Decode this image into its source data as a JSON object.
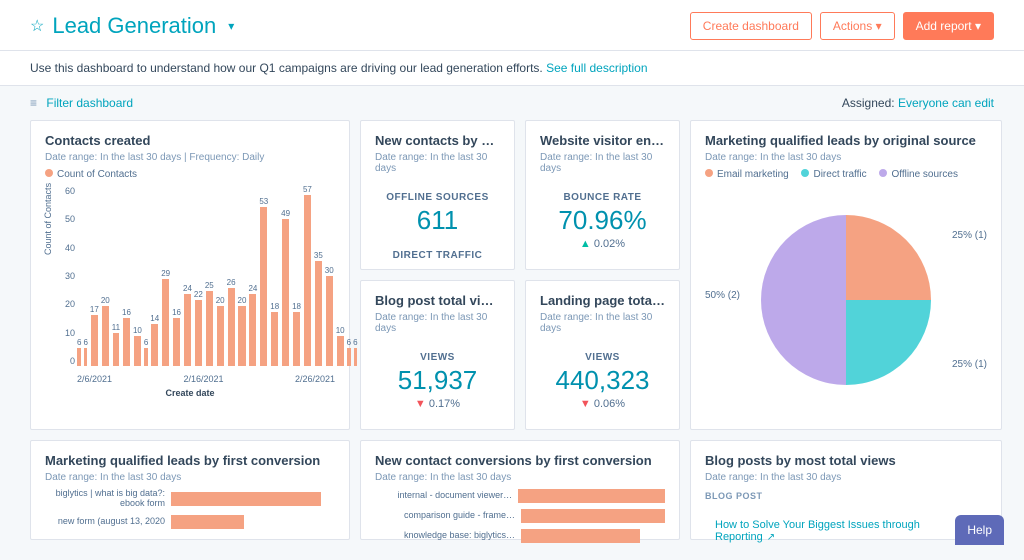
{
  "header": {
    "title": "Lead Generation",
    "create_btn": "Create dashboard",
    "actions_btn": "Actions",
    "add_report_btn": "Add report"
  },
  "description": "Use this dashboard to understand how our Q1 campaigns are driving our lead generation efforts.",
  "see_full": "See full description",
  "filter_label": "Filter dashboard",
  "assigned_label": "Assigned:",
  "assigned_value": "Everyone can edit",
  "cards": {
    "contacts_created": {
      "title": "Contacts created",
      "meta": "Date range: In the last 30 days   |   Frequency: Daily",
      "legend": "Count of Contacts",
      "xtitle": "Create date"
    },
    "new_contacts_source": {
      "title": "New contacts by sou…",
      "meta": "Date range: In the last 30 days",
      "label1": "OFFLINE SOURCES",
      "val1": "611",
      "label2": "DIRECT TRAFFIC"
    },
    "visitor_engagement": {
      "title": "Website visitor enga…",
      "meta": "Date range: In the last 30 days",
      "label": "BOUNCE RATE",
      "value": "70.96%",
      "delta": "0.02%"
    },
    "blog_views": {
      "title": "Blog post total views…",
      "meta": "Date range: In the last 30 days",
      "label": "VIEWS",
      "value": "51,937",
      "delta": "0.17%"
    },
    "landing_views": {
      "title": "Landing page total vi…",
      "meta": "Date range: In the last 30 days",
      "label": "VIEWS",
      "value": "440,323",
      "delta": "0.06%"
    },
    "mql_source": {
      "title": "Marketing qualified leads by original source",
      "meta": "Date range: In the last 30 days",
      "legend": {
        "a": "Email marketing",
        "b": "Direct traffic",
        "c": "Offline sources"
      },
      "labels": {
        "l1": "25% (1)",
        "l2": "25% (1)",
        "l3": "50% (2)"
      }
    },
    "mql_first": {
      "title": "Marketing qualified leads by first conversion",
      "meta": "Date range: In the last 30 days",
      "rows": [
        "biglytics | what is big data?: ebook form",
        "new form (august 13, 2020"
      ]
    },
    "new_contact_conv": {
      "title": "New contact conversions by first conversion",
      "meta": "Date range: In the last 30 days",
      "rows": [
        "internal - document viewer…",
        "comparison guide - frame…",
        "knowledge base: biglytics…"
      ]
    },
    "blog_posts": {
      "title": "Blog posts by most total views",
      "meta": "Date range: In the last 30 days",
      "tag": "BLOG POST",
      "link": "How to Solve Your Biggest Issues through Reporting"
    }
  },
  "help_label": "Help",
  "chart_data": {
    "contacts_created": {
      "type": "bar",
      "title": "Contacts created",
      "ylabel": "Count of Contacts",
      "xlabel": "Create date",
      "ylim": [
        0,
        60
      ],
      "yticks": [
        0,
        10,
        20,
        30,
        40,
        50,
        60
      ],
      "xticks": [
        "2/6/2021",
        "2/16/2021",
        "2/26/2021"
      ],
      "values": [
        6,
        6,
        17,
        20,
        11,
        16,
        10,
        6,
        14,
        29,
        16,
        24,
        22,
        25,
        20,
        26,
        20,
        24,
        53,
        18,
        49,
        18,
        57,
        35,
        30,
        10,
        6,
        6
      ],
      "series_name": "Count of Contacts",
      "color": "#f5a282"
    },
    "mql_by_source": {
      "type": "pie",
      "title": "Marketing qualified leads by original source",
      "series": [
        {
          "name": "Email marketing",
          "value": 1,
          "pct": 25,
          "color": "#f5a282"
        },
        {
          "name": "Direct traffic",
          "value": 1,
          "pct": 25,
          "color": "#51d3d9"
        },
        {
          "name": "Offline sources",
          "value": 2,
          "pct": 50,
          "color": "#bda9ea"
        }
      ]
    },
    "mql_first_conversion": {
      "type": "bar_horizontal",
      "categories": [
        "biglytics | what is big data?: ebook form",
        "new form (august 13, 2020"
      ],
      "values": [
        185,
        90
      ]
    },
    "new_contact_conversions": {
      "type": "bar_horizontal",
      "categories": [
        "internal - document viewer…",
        "comparison guide - frame…",
        "knowledge base: biglytics…"
      ],
      "values": [
        120,
        115,
        95
      ]
    }
  }
}
